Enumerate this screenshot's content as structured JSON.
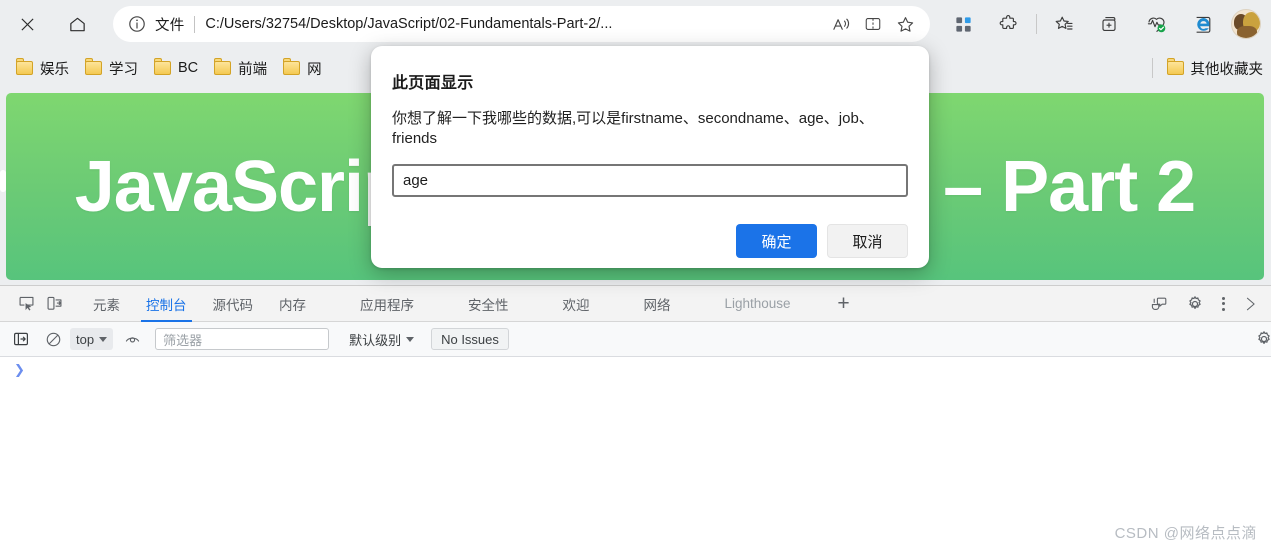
{
  "browser": {
    "close_title": "Close",
    "home_title": "Home",
    "omnibox": {
      "file_label": "文件",
      "url": "C:/Users/32754/Desktop/JavaScript/02-Fundamentals-Part-2/...",
      "read_aloud_icon": "read-aloud-icon",
      "split_screen_icon": "split-screen-icon",
      "favorite_icon": "star-icon"
    },
    "toolbar_icons": [
      "app-grid-icon",
      "extensions-puzzle-icon",
      "favorites-star-list-icon",
      "collections-icon",
      "browser-essentials-icon",
      "ie-mode-icon"
    ]
  },
  "bookmarks": {
    "items": [
      {
        "label": "娱乐"
      },
      {
        "label": "学习"
      },
      {
        "label": "BC"
      },
      {
        "label": "前端"
      },
      {
        "label": "网"
      }
    ],
    "other_favorites": {
      "label": "其他收藏夹"
    }
  },
  "page_content": {
    "hero_title": "JavaScript Fundamentals – Part 2",
    "gradient_from": "#7fd770",
    "gradient_to": "#57c47c"
  },
  "dialog": {
    "title": "此页面显示",
    "message": "你想了解一下我哪些的数据,可以是firstname、secondname、age、job、friends",
    "input_value": "age",
    "input_placeholder": "",
    "ok_label": "确定",
    "cancel_label": "取消",
    "primary_color": "#1b73e8"
  },
  "devtools": {
    "inspect_icon": "inspect-element-icon",
    "device_icon": "device-toolbar-icon",
    "tabs": [
      {
        "label": "元素",
        "active": false,
        "dim": false
      },
      {
        "label": "控制台",
        "active": true,
        "dim": false
      },
      {
        "label": "源代码",
        "active": false,
        "dim": false
      },
      {
        "label": "内存",
        "active": false,
        "dim": false
      },
      {
        "label": "应用程序",
        "active": false,
        "dim": false
      },
      {
        "label": "安全性",
        "active": false,
        "dim": false
      },
      {
        "label": "欢迎",
        "active": false,
        "dim": false
      },
      {
        "label": "网络",
        "active": false,
        "dim": false
      },
      {
        "label": "Lighthouse",
        "active": false,
        "dim": true
      }
    ],
    "add_tab_label": "+",
    "right_icons": [
      "feedback-icon",
      "settings-gear-icon",
      "more-options-icon",
      "close-devtools-icon"
    ],
    "console_toolbar": {
      "sidebar_toggle_icon": "console-sidebar-icon",
      "clear_console_icon": "clear-console-icon",
      "context_label": "top",
      "live_expression_icon": "eye-icon",
      "filter_placeholder": "筛选器",
      "level_label": "默认级别",
      "issues_label": "No Issues",
      "settings_icon": "console-settings-gear-icon"
    },
    "prompt_caret": "❯"
  },
  "watermark": "CSDN @网络点点滴"
}
